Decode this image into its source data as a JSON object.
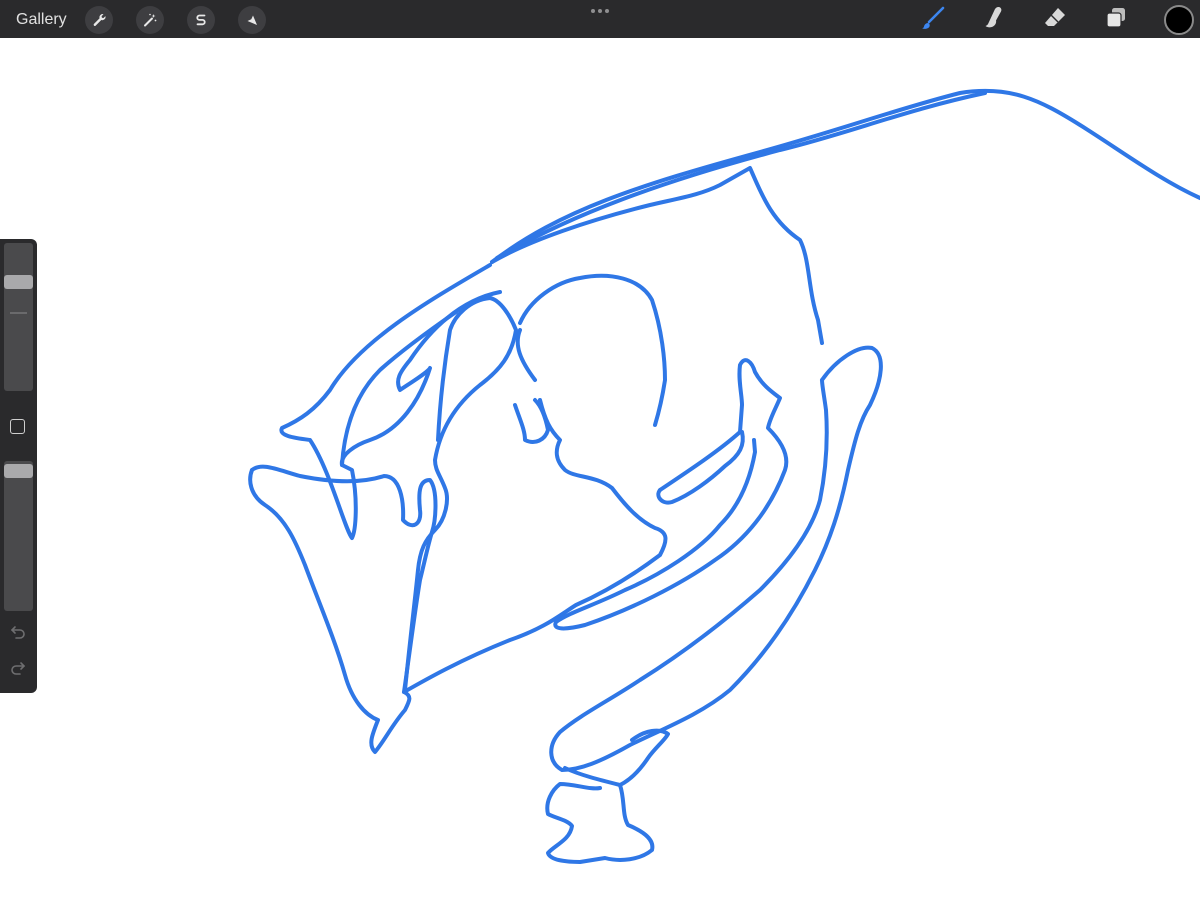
{
  "topbar": {
    "gallery_label": "Gallery",
    "left_tools": [
      {
        "name": "actions",
        "icon": "wrench-icon"
      },
      {
        "name": "adjustments",
        "icon": "magic-wand-icon"
      },
      {
        "name": "selection",
        "icon": "selection-s-icon"
      },
      {
        "name": "transform",
        "icon": "arrow-cursor-icon"
      }
    ],
    "more_icon": "more-dots-icon",
    "right_tools": [
      {
        "name": "brush",
        "icon": "brush-icon",
        "active": true
      },
      {
        "name": "smudge",
        "icon": "smudge-finger-icon",
        "active": false
      },
      {
        "name": "eraser",
        "icon": "eraser-icon",
        "active": false
      },
      {
        "name": "layers",
        "icon": "layers-icon",
        "active": false
      }
    ],
    "current_color": "#000000"
  },
  "sidebar": {
    "brush_size_level": 0.24,
    "brush_opacity_level": 0.02,
    "modify_icon": "square-icon",
    "undo_icon": "undo-icon",
    "redo_icon": "redo-icon"
  },
  "canvas": {
    "stroke_color": "#2f77e6",
    "background": "#ffffff"
  }
}
